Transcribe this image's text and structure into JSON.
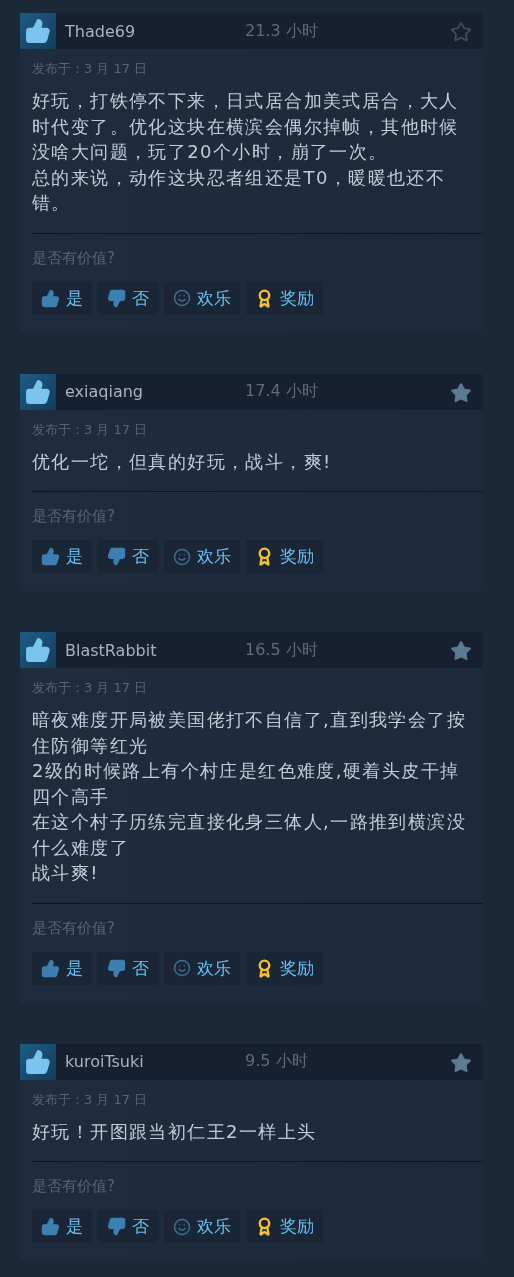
{
  "reviews": [
    {
      "author": "Thade69",
      "hours": "21.3 小时",
      "starred": false,
      "posted": "发布于：3 月 17 日",
      "text": [
        "好玩，打铁停不下来，日式居合加美式居合，大人时代变了。优化这块在横滨会偶尔掉帧，其他时候没啥大问题，玩了20个小时，崩了一次。",
        "总的来说，动作这块忍者组还是T0，暖暖也还不错。"
      ],
      "question": "是否有价值?",
      "buttons": [
        {
          "kind": "yes",
          "label": "是"
        },
        {
          "kind": "no",
          "label": "否"
        },
        {
          "kind": "funny",
          "label": "欢乐"
        },
        {
          "kind": "award",
          "label": "奖励"
        }
      ]
    },
    {
      "author": "exiaqiang",
      "hours": "17.4 小时",
      "starred": true,
      "posted": "发布于：3 月 17 日",
      "text": [
        "优化一坨，但真的好玩，战斗，爽!"
      ],
      "question": "是否有价值?",
      "buttons": [
        {
          "kind": "yes",
          "label": "是"
        },
        {
          "kind": "no",
          "label": "否"
        },
        {
          "kind": "funny",
          "label": "欢乐"
        },
        {
          "kind": "award",
          "label": "奖励"
        }
      ]
    },
    {
      "author": "BlastRabbit",
      "hours": "16.5 小时",
      "starred": true,
      "posted": "发布于：3 月 17 日",
      "text": [
        "暗夜难度开局被美国佬打不自信了,直到我学会了按住防御等红光",
        "2级的时候路上有个村庄是红色难度,硬着头皮干掉四个高手",
        "在这个村子历练完直接化身三体人,一路推到横滨没什么难度了",
        "战斗爽!"
      ],
      "question": "是否有价值?",
      "buttons": [
        {
          "kind": "yes",
          "label": "是"
        },
        {
          "kind": "no",
          "label": "否"
        },
        {
          "kind": "funny",
          "label": "欢乐"
        },
        {
          "kind": "award",
          "label": "奖励"
        }
      ]
    },
    {
      "author": "kuroiTsuki",
      "hours": "9.5 小时",
      "starred": true,
      "posted": "发布于：3 月 17 日",
      "text": [
        "好玩！开图跟当初仁王2一样上头"
      ],
      "question": "是否有价值?",
      "buttons": [
        {
          "kind": "yes",
          "label": "是"
        },
        {
          "kind": "no",
          "label": "否"
        },
        {
          "kind": "funny",
          "label": "欢乐"
        },
        {
          "kind": "award",
          "label": "奖励"
        }
      ]
    }
  ]
}
